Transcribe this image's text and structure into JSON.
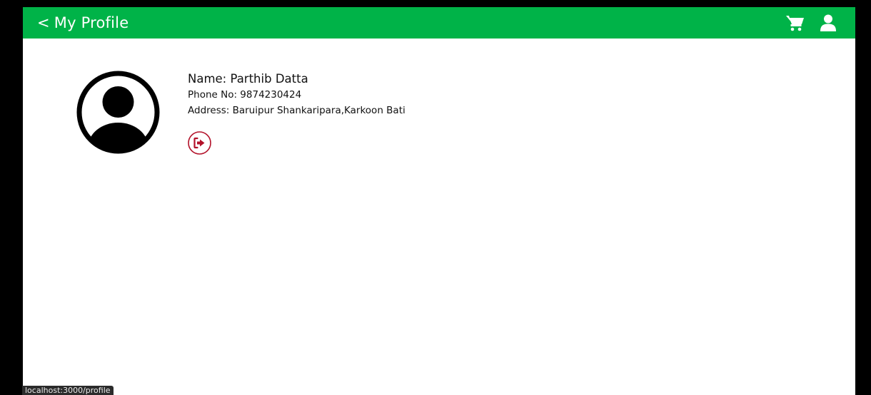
{
  "header": {
    "back_chevron": "<",
    "title": "My Profile",
    "bg_color": "#00b348",
    "icons": [
      "cart-icon",
      "user-icon"
    ]
  },
  "profile": {
    "name": "Name: Parthib Datta",
    "phone": "Phone No: 9874230424",
    "address": "Address: Baruipur Shankaripara,Karkoon Bati",
    "avatar_icon": "user-circle-icon",
    "logout_icon": "sign-out-icon",
    "logout_color": "#b3122a"
  },
  "status_bar": {
    "url": "localhost:3000/profile"
  }
}
